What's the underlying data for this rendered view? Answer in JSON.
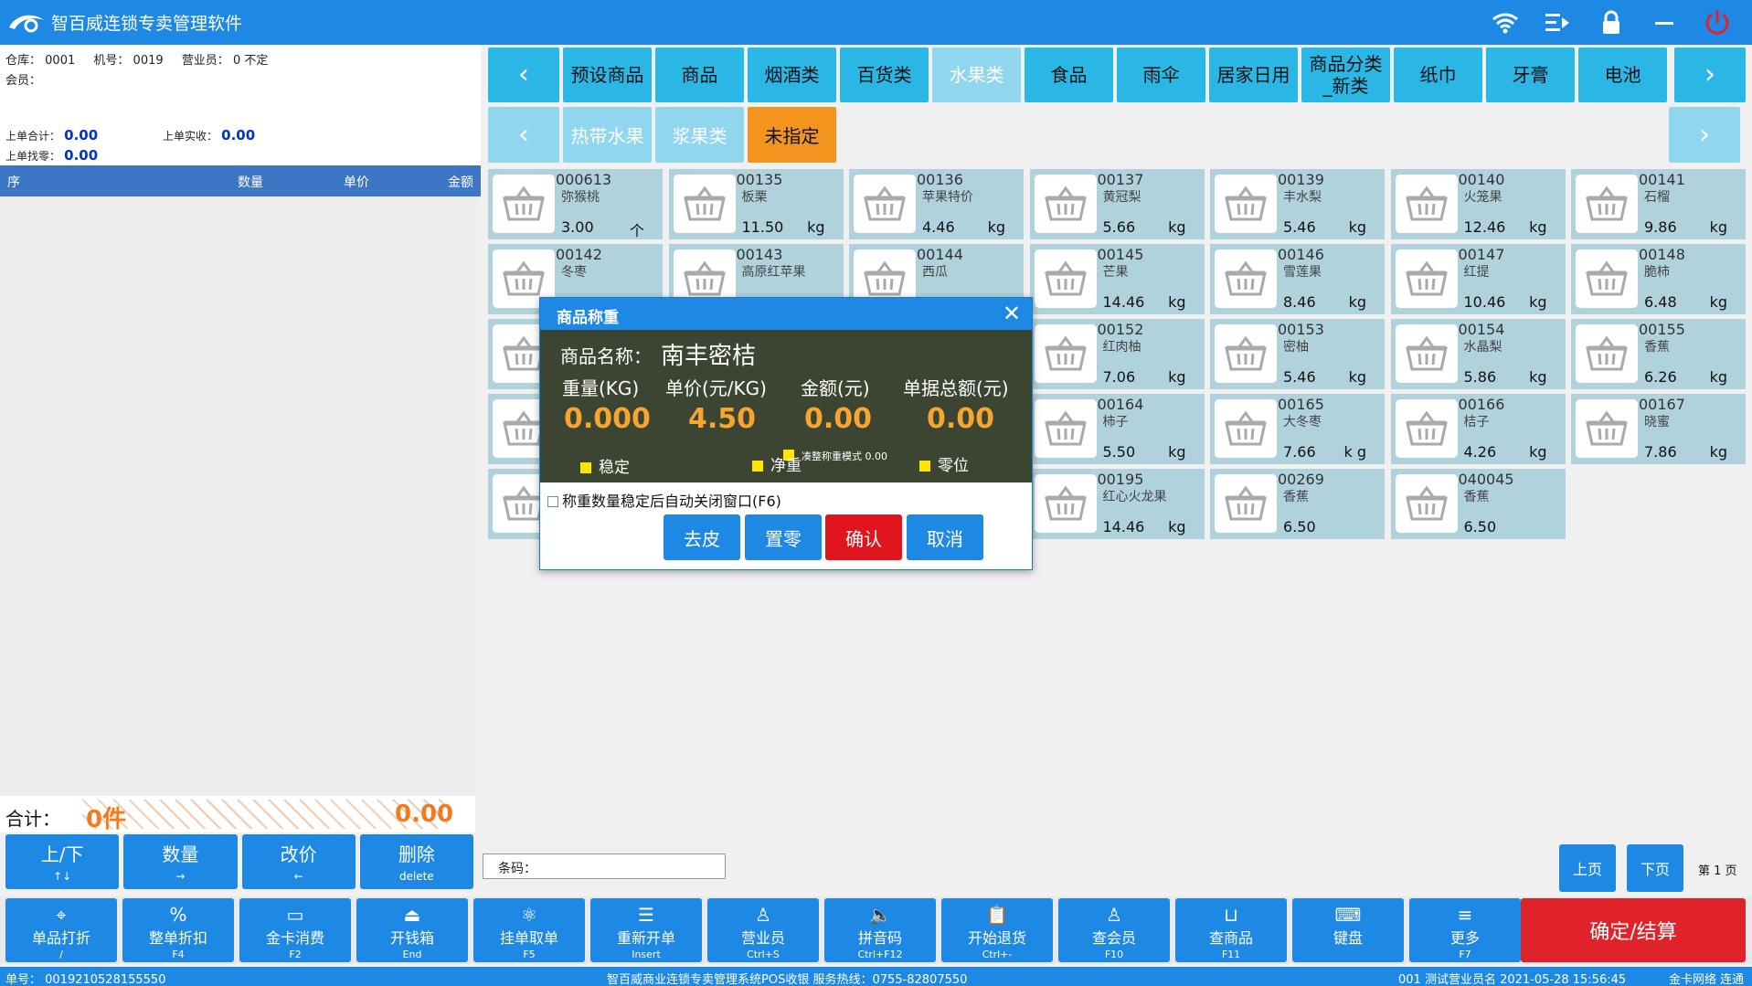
{
  "app": {
    "title": "智百威连锁专卖管理软件"
  },
  "header_icons": [
    "wifi-icon",
    "exit-menu-icon",
    "lock-icon",
    "minimize-icon",
    "power-icon"
  ],
  "info": {
    "warehouse_label": "仓库：",
    "warehouse": "0001",
    "machine_label": "机号：",
    "machine": "0019",
    "clerk_label": "营业员：",
    "clerk": "0 不定",
    "member_label": "会员：",
    "last_total_label": "上单合计：",
    "last_total": "0.00",
    "last_paid_label": "上单实收：",
    "last_paid": "0.00",
    "last_change_label": "上单找零：",
    "last_change": "0.00"
  },
  "order_columns": [
    "序",
    "数量",
    "单价",
    "金额"
  ],
  "totals": {
    "label": "合计：",
    "count": "0件",
    "amount": "0.00"
  },
  "left_buttons": [
    {
      "label": "上/下",
      "key": "↑↓"
    },
    {
      "label": "数量",
      "key": "→"
    },
    {
      "label": "改价",
      "key": "←"
    },
    {
      "label": "删除",
      "key": "delete"
    }
  ],
  "categories": [
    "预设商品",
    "商品",
    "烟酒类",
    "百货类",
    "水果类",
    "食品",
    "雨伞",
    "居家日用",
    "商品分类_新类",
    "纸巾",
    "牙膏",
    "电池"
  ],
  "categories_selected": 4,
  "subcategories": [
    "热带水果",
    "浆果类",
    "未指定"
  ],
  "subcategories_selected": 2,
  "products": [
    {
      "code": "000613",
      "name": "弥猴桃",
      "price": "3.00",
      "unit": "个"
    },
    {
      "code": "00135",
      "name": "板栗",
      "price": "11.50",
      "unit": "kg"
    },
    {
      "code": "00136",
      "name": "苹果特价",
      "price": "4.46",
      "unit": "kg"
    },
    {
      "code": "00137",
      "name": "黄冠梨",
      "price": "5.66",
      "unit": "kg"
    },
    {
      "code": "00139",
      "name": "丰水梨",
      "price": "5.46",
      "unit": "kg"
    },
    {
      "code": "00140",
      "name": "火笼果",
      "price": "12.46",
      "unit": "kg"
    },
    {
      "code": "00141",
      "name": "石榴",
      "price": "9.86",
      "unit": "kg"
    },
    {
      "code": "00142",
      "name": "冬枣",
      "price": "",
      "unit": ""
    },
    {
      "code": "00143",
      "name": "高原红苹果",
      "price": "",
      "unit": ""
    },
    {
      "code": "00144",
      "name": "西瓜",
      "price": "",
      "unit": ""
    },
    {
      "code": "00145",
      "name": "芒果",
      "price": "14.46",
      "unit": "kg"
    },
    {
      "code": "00146",
      "name": "雪莲果",
      "price": "8.46",
      "unit": "kg"
    },
    {
      "code": "00147",
      "name": "红提",
      "price": "10.46",
      "unit": "kg"
    },
    {
      "code": "00148",
      "name": "脆柿",
      "price": "6.48",
      "unit": "kg"
    },
    {
      "code": "",
      "name": "",
      "price": "",
      "unit": ""
    },
    {
      "code": "",
      "name": "",
      "price": "",
      "unit": ""
    },
    {
      "code": "",
      "name": "",
      "price": "",
      "unit": ""
    },
    {
      "code": "00152",
      "name": "红肉柚",
      "price": "7.06",
      "unit": "kg"
    },
    {
      "code": "00153",
      "name": "密柚",
      "price": "5.46",
      "unit": "kg"
    },
    {
      "code": "00154",
      "name": "水晶梨",
      "price": "5.86",
      "unit": "kg"
    },
    {
      "code": "00155",
      "name": "香蕉",
      "price": "6.26",
      "unit": "kg"
    },
    {
      "code": "",
      "name": "",
      "price": "",
      "unit": ""
    },
    {
      "code": "",
      "name": "",
      "price": "",
      "unit": ""
    },
    {
      "code": "",
      "name": "",
      "price": "",
      "unit": ""
    },
    {
      "code": "00164",
      "name": "柿子",
      "price": "5.50",
      "unit": "kg"
    },
    {
      "code": "00165",
      "name": "大冬枣",
      "price": "7.66",
      "unit": "k g"
    },
    {
      "code": "00166",
      "name": "桔子",
      "price": "4.26",
      "unit": "kg"
    },
    {
      "code": "00167",
      "name": "晓蜜",
      "price": "7.86",
      "unit": "kg"
    },
    {
      "code": "",
      "name": "",
      "price": "",
      "unit": ""
    },
    {
      "code": "",
      "name": "",
      "price": "",
      "unit": ""
    },
    {
      "code": "",
      "name": "",
      "price": "",
      "unit": ""
    },
    {
      "code": "00195",
      "name": "红心火龙果",
      "price": "14.46",
      "unit": "kg"
    },
    {
      "code": "00269",
      "name": "香蕉",
      "price": "6.50",
      "unit": ""
    },
    {
      "code": "040045",
      "name": "香蕉",
      "price": "6.50",
      "unit": ""
    }
  ],
  "barcode": {
    "label": "条码："
  },
  "pager": {
    "prev": "上页",
    "next": "下页",
    "page": "第 1 页"
  },
  "bottom_buttons": [
    {
      "label": "单品打折",
      "key": "/",
      "icon": "tag-icon"
    },
    {
      "label": "整单折扣",
      "key": "F4",
      "icon": "percent-icon"
    },
    {
      "label": "金卡消费",
      "key": "F2",
      "icon": "card-icon"
    },
    {
      "label": "开钱箱",
      "key": "End",
      "icon": "cashbox-icon"
    },
    {
      "label": "挂单取单",
      "key": "F5",
      "icon": "atom-icon"
    },
    {
      "label": "重新开单",
      "key": "Insert",
      "icon": "list-reset-icon"
    },
    {
      "label": "营业员",
      "key": "Ctrl+S",
      "icon": "user-icon"
    },
    {
      "label": "拼音码",
      "key": "Ctrl+F12",
      "icon": "speaker-icon"
    },
    {
      "label": "开始退货",
      "key": "Ctrl+-",
      "icon": "clipboard-icon"
    },
    {
      "label": "查会员",
      "key": "F10",
      "icon": "member-search-icon"
    },
    {
      "label": "查商品",
      "key": "F11",
      "icon": "basket-icon"
    },
    {
      "label": "键盘",
      "key": "",
      "icon": "keyboard-icon"
    },
    {
      "label": "更多",
      "key": "F7",
      "icon": "more-icon"
    }
  ],
  "settle_button": "确定/结算",
  "status": {
    "order_no": "单号： 0019210528155550",
    "center": "智百威商业连锁专卖管理系统POS收银   服务热线：0755-82807550",
    "right": "001 测试营业员名 2021-05-28 15:56:45",
    "network": "金卡网络 连通"
  },
  "dialog": {
    "title": "商品称重",
    "name_label": "商品名称：",
    "name": "南丰密桔",
    "weight_label": "重量(KG)",
    "price_label": "单价(元/KG)",
    "amount_label": "金额(元)",
    "total_label": "单据总额(元)",
    "weight": "0.000",
    "price": "4.50",
    "amount": "0.00",
    "total": "0.00",
    "round_mode": "凑整称重模式 0.00",
    "stable": "稳定",
    "net": "净重",
    "zero": "零位",
    "auto_close": "称重数量稳定后自动关闭窗口(F6)",
    "btn_tare": "去皮",
    "btn_zero": "置零",
    "btn_ok": "确认",
    "btn_cancel": "取消"
  }
}
